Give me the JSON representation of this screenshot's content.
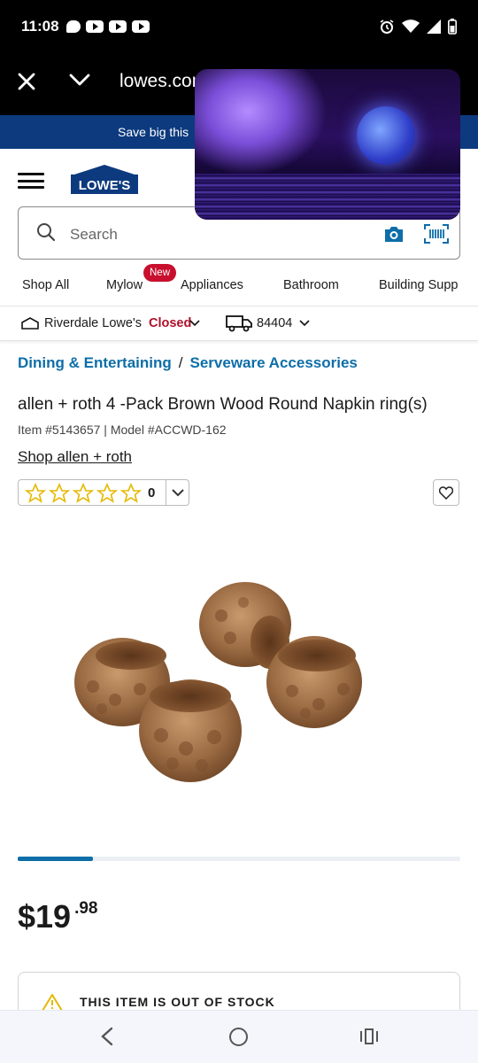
{
  "status": {
    "time": "11:08",
    "left_icons": [
      "chat-icon",
      "youtube-icon",
      "youtube-icon",
      "youtube-icon"
    ],
    "right_icons": [
      "alarm-icon",
      "wifi-icon",
      "signal-icon",
      "battery-icon"
    ]
  },
  "browser": {
    "url": "lowes.com"
  },
  "promo": {
    "text": "Save big this"
  },
  "header": {
    "logo_text": "LOWE'S"
  },
  "search": {
    "placeholder": "Search"
  },
  "categories": [
    {
      "label": "Shop All"
    },
    {
      "label": "Mylow",
      "badge": "New"
    },
    {
      "label": "Appliances"
    },
    {
      "label": "Bathroom"
    },
    {
      "label": "Building Supp"
    }
  ],
  "store": {
    "name": "Riverdale Lowe's",
    "status": "Closed",
    "zip": "84404"
  },
  "breadcrumb": {
    "items": [
      "Dining & Entertaining",
      "Serveware Accessories"
    ],
    "separator": "/"
  },
  "product": {
    "title": "allen + roth 4 -Pack Brown Wood Round Napkin ring(s)",
    "item_line": "Item #5143657 | Model #ACCWD-162",
    "brand_link": "Shop allen + roth",
    "rating": {
      "stars": 0,
      "max": 5,
      "review_count": "0"
    },
    "image_progress": 0.17,
    "price": {
      "dollars": "$19",
      "cents": ".98"
    },
    "stock_message": "THIS ITEM IS OUT OF STOCK"
  },
  "colors": {
    "brand_blue": "#0d3a7e",
    "link_blue": "#0d6ea8",
    "star_gold": "#e6b800",
    "closed_red": "#b0102a",
    "badge_red": "#c8102e"
  }
}
